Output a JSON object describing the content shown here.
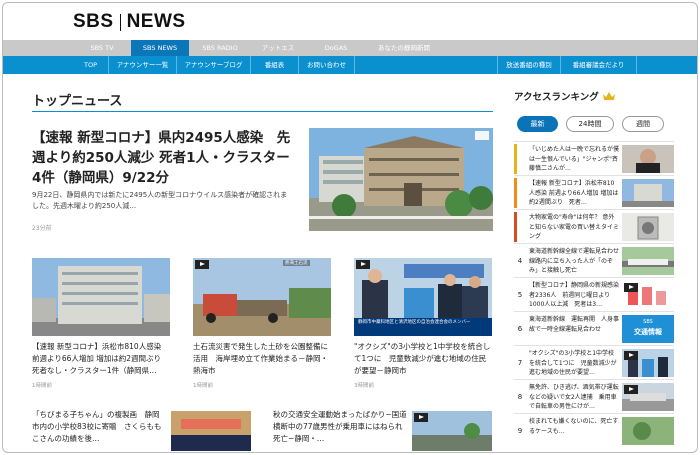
{
  "header": {
    "logo_left": "SBS",
    "logo_right": "NEWS"
  },
  "nav_primary": [
    "SBS TV",
    "SBS NEWS",
    "SBS RADIO",
    "アットエス",
    "DoGAS",
    "あなたの静岡新聞"
  ],
  "nav_secondary": [
    "TOP",
    "アナウンサー一覧",
    "アナウンサーブログ",
    "番組表",
    "お問い合わせ",
    "放送番組の種別",
    "番組審議会だより"
  ],
  "section_title": "トップニュース",
  "lead": {
    "title": "【速報 新型コロナ】県内2495人感染　先週より約250人減少 死者1人・クラスター4件（静岡県）9/22分",
    "summary": "9月22日、静岡県内では新たに2495人の新型コロナウイルス感染者が確認されました。先週木曜より約250人減…",
    "time": "23分前"
  },
  "cards": [
    {
      "title": "【速報 新型コロナ】浜松市810人感染 前週より66人増加 増加は約2週間ぶり 死者なし・クラスター1件（静岡県…",
      "time": "1時間前"
    },
    {
      "title": "土石流災害で発生した土砂を公園整備に活用　海岸埋め立て作業始まる－静岡・熱海市",
      "time": "1時間前",
      "caption": "熱海土石流"
    },
    {
      "title": "\"オクシズ\"の3小学校と1中学校を統合して1つに　児童数減少が進む地域の住民が要望－静岡市",
      "time": "3時間前",
      "caption": "静岡市中藁科地区と清沢地区の自治会連合会のメンバー"
    }
  ],
  "bottom": [
    {
      "title": "「ちびまる子ちゃん」の複製画　静岡市内の小学校83校に寄贈　さくらももこさんの功績を後…"
    },
    {
      "title": "秋の交通安全運動始まったばかり−国道横断中の77歳男性が乗用車にはねられ死亡−静岡・…"
    }
  ],
  "sidebar": {
    "title": "アクセスランキング",
    "tabs": [
      "最新",
      "24時間",
      "週間"
    ],
    "ranking": [
      {
        "num": "1",
        "title": "「いじめた人は一晩で忘れるが僕は一生恨んでいる」\"ジャンポ\"斉藤慎二さんが…"
      },
      {
        "num": "2",
        "title": "【速報 新型コロナ】浜松市810人感染 前週より66人増加 増加は約2週間ぶり　死者…"
      },
      {
        "num": "3",
        "title": "大物家電の\"寿命\"は何年？ 意外と知らない家電の買い替えタイミング"
      },
      {
        "num": "4",
        "title": "東海道新幹線全線で運転見合わせ　線路内に立ち入った人が「のぞみ」と接触し死亡"
      },
      {
        "num": "5",
        "title": "【新型コロナ】静岡県の新規感染者2336人　前週同じ曜日より1000人以上減　死者は3…"
      },
      {
        "num": "6",
        "title": "東海道新幹線　運転再開　人身事故で一時全線運転見合わせ"
      },
      {
        "num": "7",
        "title": "\"オクシズ\"の3小学校と1中学校を統合して1つに　児童数減少が進む地域の住民が要望…"
      },
      {
        "num": "8",
        "title": "無免許、ひき逃げ、酒気帯び運転などの疑いで女2人逮捕　乗用車で自転車の男性にけが…"
      },
      {
        "num": "9",
        "title": "校まれても嫌くないのに、死亡するケースも…"
      }
    ],
    "thumb_caption_sbs": "SBS",
    "thumb_caption_traffic": "交通情報"
  },
  "colors": {
    "accent_blue": "#0a8fcf",
    "active_tab": "#0b73b8",
    "rank1": "#e8b21b",
    "rank2": "#f08c1a",
    "rank3": "#d64d1f"
  }
}
